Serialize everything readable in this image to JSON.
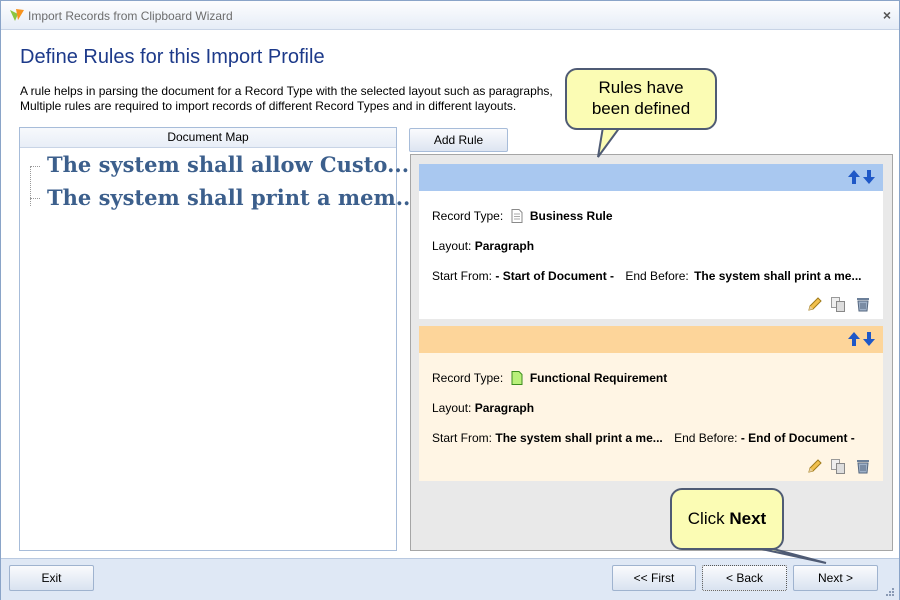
{
  "window": {
    "title": "Import Records from Clipboard Wizard",
    "close_glyph": "×"
  },
  "page": {
    "heading": "Define Rules for this Import Profile",
    "description_line1": "A rule helps in parsing the document for a Record Type with the selected layout such as paragraphs,",
    "description_line2": "Multiple rules are required to import records of different Record Types and in different layouts."
  },
  "document_map": {
    "header": "Document Map",
    "items": [
      "The system shall allow Custo...",
      "The system shall print a mem..."
    ]
  },
  "toolbar": {
    "add_rule_label": "Add Rule"
  },
  "rules": [
    {
      "record_type_label": "Record Type:",
      "record_type": "Business Rule",
      "layout_label": "Layout:",
      "layout": "Paragraph",
      "start_from_label": "Start From:",
      "start_from": "- Start of Document -",
      "end_before_label": "End Before:",
      "end_before": "The system shall print a me...",
      "header_color": "#a9c8f0",
      "body_color": "#ffffff"
    },
    {
      "record_type_label": "Record Type:",
      "record_type": "Functional Requirement",
      "layout_label": "Layout:",
      "layout": "Paragraph",
      "start_from_label": "Start From:",
      "start_from": "The system shall print a me...",
      "end_before_label": "End Before:",
      "end_before": "- End of Document -",
      "header_color": "#fdd59a",
      "body_color": "#fff5e4"
    }
  ],
  "callouts": {
    "rules_line1": "Rules have",
    "rules_line2": "been defined",
    "next_prefix": "Click ",
    "next_bold": "Next"
  },
  "buttons": {
    "exit": "Exit",
    "first": "<< First",
    "back": "< Back",
    "next": "Next >"
  },
  "colors": {
    "heading": "#1d3a8a",
    "doc_map_text": "#3c5f8c",
    "callout_fill": "#fbfcb4",
    "bottom_bar": "#dfe8f5"
  },
  "icons": {
    "app": "app-logo-icon",
    "close": "close-icon",
    "up": "arrow-up-icon",
    "down": "arrow-down-icon",
    "edit": "pencil-icon",
    "copy": "copy-icon",
    "delete": "trash-icon",
    "business_rule": "document-icon",
    "functional_requirement": "green-document-icon"
  }
}
